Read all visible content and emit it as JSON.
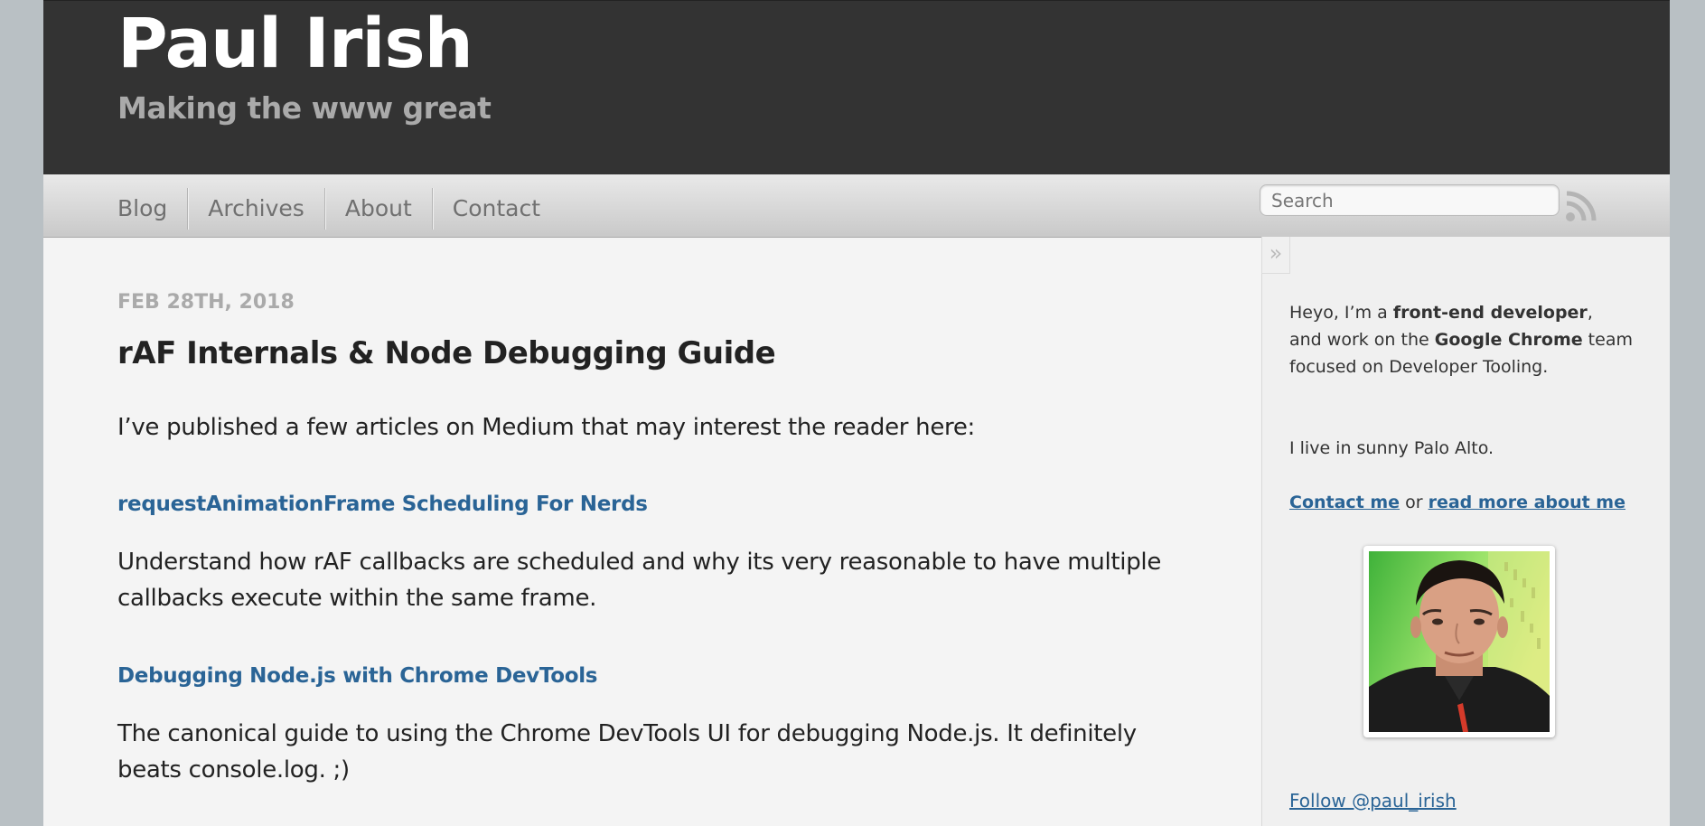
{
  "header": {
    "title": "Paul Irish",
    "subtitle": "Making the www great"
  },
  "nav": {
    "items": [
      {
        "label": "Blog"
      },
      {
        "label": "Archives"
      },
      {
        "label": "About"
      },
      {
        "label": "Contact"
      }
    ],
    "search_placeholder": "Search",
    "rss_icon": "rss-icon"
  },
  "post": {
    "date": "FEB 28TH, 2018",
    "title": "rAF Internals & Node Debugging Guide",
    "intro": "I’ve published a few articles on Medium that may interest the reader here:",
    "articles": [
      {
        "link": "requestAnimationFrame Scheduling For Nerds",
        "description": "Understand how rAF callbacks are scheduled and why its very reasonable to have multiple callbacks execute within the same frame."
      },
      {
        "link": "Debugging Node.js with Chrome DevTools",
        "description": "The canonical guide to using the Chrome DevTools UI for debugging Node.js. It definitely beats console.log. ;)"
      }
    ]
  },
  "sidebar": {
    "toggle": "»",
    "bio": {
      "line1_prefix": "Heyo, I’m a ",
      "line1_bold": "front-end developer",
      "line1_suffix": ",",
      "line2_prefix": "and work on the ",
      "line2_bold": "Google Chrome",
      "line2_suffix": " team",
      "line3": "focused on Developer Tooling."
    },
    "location": "I live in sunny Palo Alto.",
    "contact_link": "Contact me",
    "or_text": " or ",
    "about_link": "read more about me",
    "follow_link": "Follow @paul_irish"
  },
  "colors": {
    "header_bg": "#333333",
    "link": "#2a6496",
    "page_bg": "#f4f4f4",
    "outer_bg": "#b9c0c4"
  }
}
